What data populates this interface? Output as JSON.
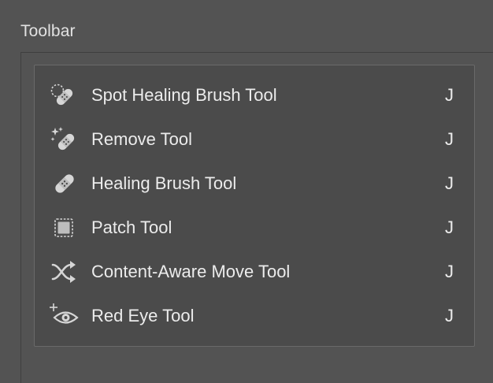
{
  "panel": {
    "title": "Toolbar"
  },
  "tools": [
    {
      "label": "Spot Healing Brush Tool",
      "shortcut": "J",
      "icon": "spot-healing-brush-icon"
    },
    {
      "label": "Remove Tool",
      "shortcut": "J",
      "icon": "remove-tool-icon"
    },
    {
      "label": "Healing Brush Tool",
      "shortcut": "J",
      "icon": "healing-brush-icon"
    },
    {
      "label": "Patch Tool",
      "shortcut": "J",
      "icon": "patch-tool-icon"
    },
    {
      "label": "Content-Aware Move Tool",
      "shortcut": "J",
      "icon": "content-aware-move-icon"
    },
    {
      "label": "Red Eye Tool",
      "shortcut": "J",
      "icon": "red-eye-icon"
    }
  ],
  "colors": {
    "background": "#535353",
    "flyout_background": "#4b4b4b",
    "text": "#ececec",
    "icon": "#d6d6d6"
  }
}
